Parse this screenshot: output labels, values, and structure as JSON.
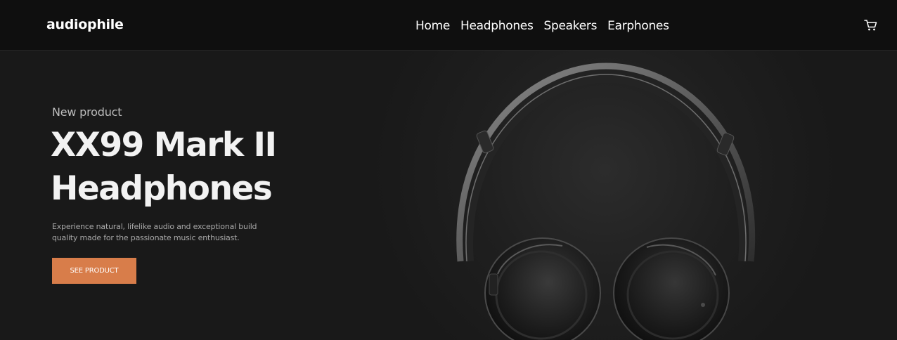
{
  "header": {
    "logo": "audiophile",
    "nav": [
      "Home",
      "Headphones",
      "Speakers",
      "Earphones"
    ],
    "cart_icon": "cart-icon"
  },
  "hero": {
    "eyebrow": "New product",
    "title_line1": "XX99 Mark II",
    "title_line2": "Headphones",
    "description": "Experience natural, lifelike audio and exceptional build quality made for the passionate music enthusiast.",
    "cta_label": "SEE PRODUCT",
    "image": "headphones-image"
  },
  "colors": {
    "accent": "#d87d4a",
    "header_bg": "#0f0f0f",
    "hero_bg": "#191919"
  }
}
